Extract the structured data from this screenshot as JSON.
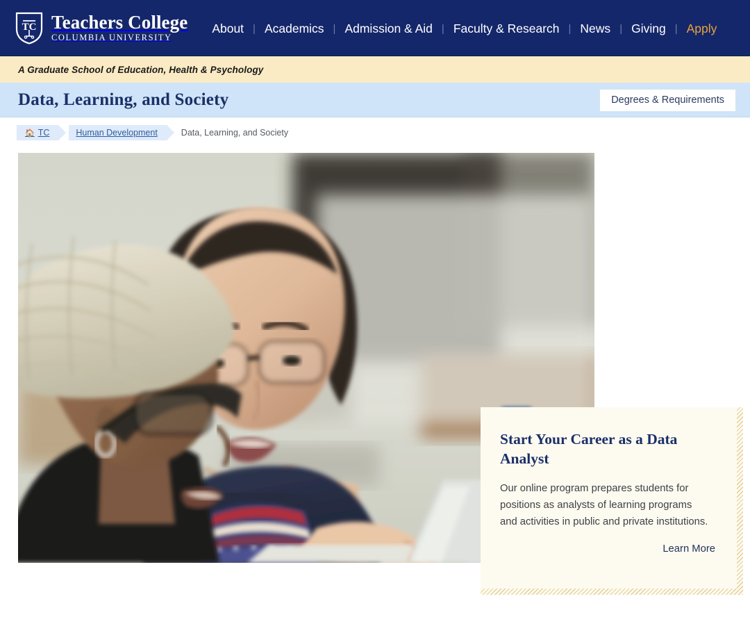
{
  "header": {
    "logo": {
      "icon": "shield-tc-icon",
      "title": "Teachers College",
      "subtitle": "COLUMBIA UNIVERSITY"
    },
    "nav_items": [
      {
        "label": "About",
        "accent": false
      },
      {
        "label": "Academics",
        "accent": false
      },
      {
        "label": "Admission & Aid",
        "accent": false
      },
      {
        "label": "Faculty & Research",
        "accent": false
      },
      {
        "label": "News",
        "accent": false
      },
      {
        "label": "Giving",
        "accent": false
      },
      {
        "label": "Apply",
        "accent": true
      }
    ],
    "separator": "|",
    "background_color": "#15276b",
    "accent_color": "#e8a33d"
  },
  "tagline_bar": {
    "text": "A Graduate School of Education, Health & Psychology",
    "background_color": "#fbebc4"
  },
  "title_bar": {
    "page_title": "Data, Learning, and Society",
    "action_button": "Degrees & Requirements",
    "background_color": "#cfe4f8",
    "title_color": "#1b3068"
  },
  "breadcrumb": {
    "home_icon": "home-icon",
    "items": [
      {
        "label": "TC",
        "type": "link"
      },
      {
        "label": "Human Development",
        "type": "link"
      },
      {
        "label": "Data, Learning, and Society",
        "type": "current"
      }
    ]
  },
  "hero": {
    "alt": "Two students working together at laptops in a computer classroom",
    "scene": {
      "foreground_subject_1": "woman in cream knit beanie and black turtleneck with glasses and hoop earring",
      "foreground_subject_2": "woman with dark ponytail, glasses and navy fair-isle patterned sweater typing on a laptop",
      "background_subject": "person in yellow shirt at a laptop in the background",
      "wall_sign": "blue accessibility sign on back wall"
    }
  },
  "callout": {
    "title": "Start Your Career as a Data Analyst",
    "body": "Our online program prepares students for positions as analysts of learning programs and activities in public and private institutions.",
    "link_label": "Learn More",
    "background_color": "#fdfaf0",
    "border_color": "#e4cf95"
  }
}
